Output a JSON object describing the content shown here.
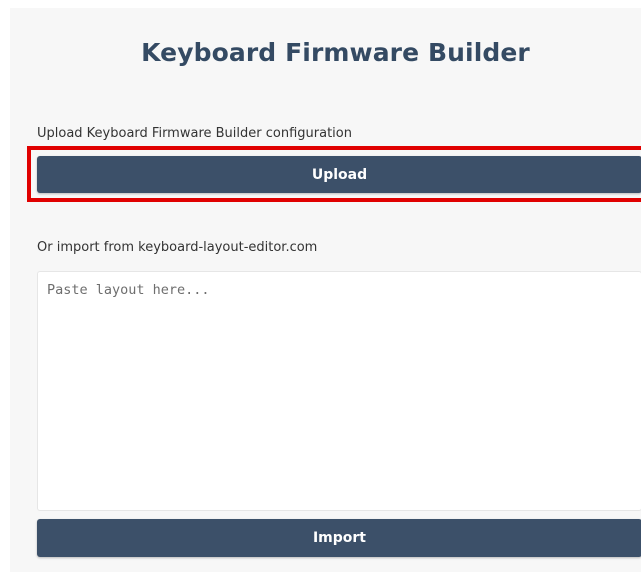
{
  "app": {
    "title": "Keyboard Firmware Builder"
  },
  "upload": {
    "label": "Upload Keyboard Firmware Builder configuration",
    "button_label": "Upload"
  },
  "import": {
    "label": "Or import from keyboard-layout-editor.com",
    "placeholder": "Paste layout here...",
    "value": "",
    "button_label": "Import"
  },
  "colors": {
    "title": "#344a63",
    "button_bg": "#3c5069",
    "highlight_border": "#e00000",
    "panel_bg": "#f7f7f7"
  }
}
